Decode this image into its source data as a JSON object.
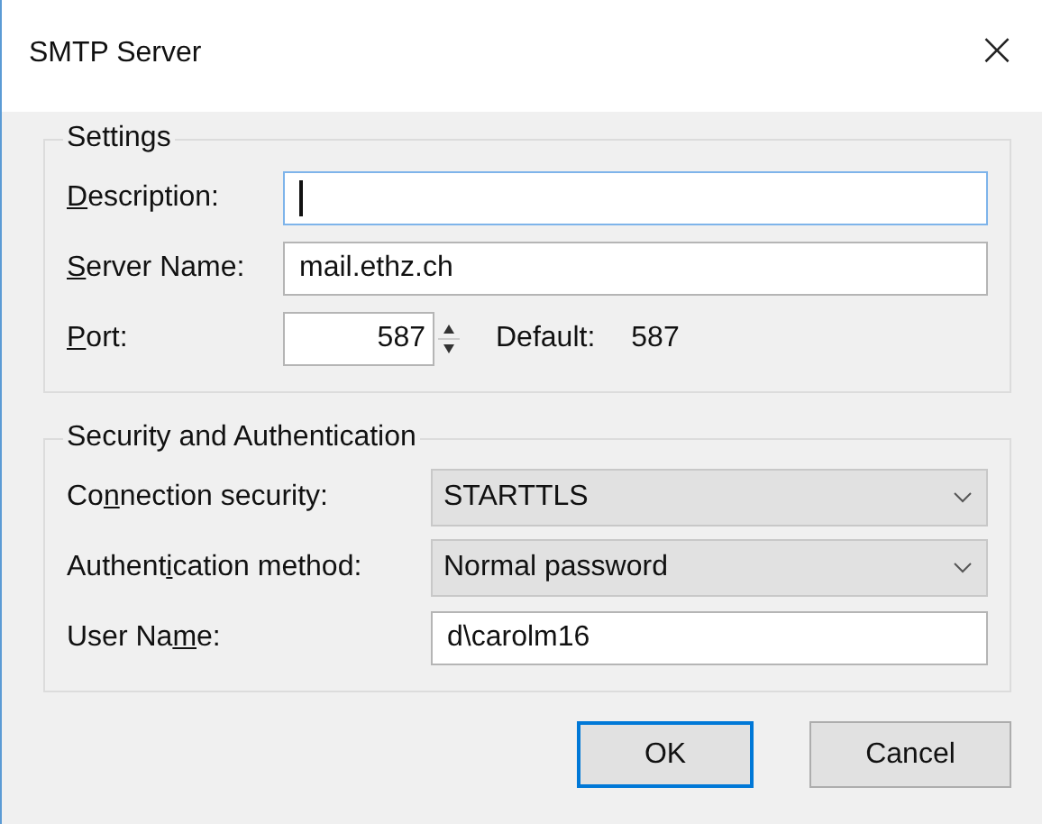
{
  "window": {
    "title": "SMTP Server",
    "close": "×"
  },
  "settings": {
    "title": "Settings",
    "fields": [
      {
        "label": {
          "key": "D",
          "after": "escription:"
        },
        "kind": "text",
        "focused": true
      },
      {
        "label": {
          "key": "S",
          "after": "erver Name:"
        },
        "kind": "text",
        "value": "mail.ethz.ch",
        "focused": false
      },
      {
        "label": {
          "key": "P",
          "after": "ort:"
        },
        "kind": "spin",
        "value": "587",
        "focused": false,
        "default_label": "Default:",
        "default_value": "587"
      }
    ]
  },
  "security": {
    "title": "Security and Authentication",
    "fields": [
      {
        "label": {
          "before": "Co",
          "key": "n",
          "after": "nection security:"
        },
        "kind": "select",
        "value": "STARTTLS"
      },
      {
        "label": {
          "before": "Authent",
          "key": "i",
          "after": "cation method:"
        },
        "kind": "select",
        "value": "Normal password"
      },
      {
        "label": {
          "before": "User Na",
          "key": "m",
          "after": "e:"
        },
        "kind": "text",
        "value": "d\\carolm16"
      }
    ]
  },
  "buttons": [
    {
      "label": "OK",
      "default": true
    },
    {
      "label": "Cancel",
      "default": false
    }
  ]
}
